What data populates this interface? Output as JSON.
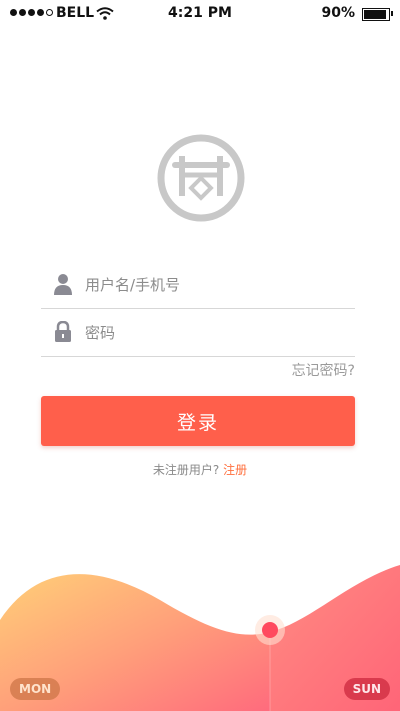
{
  "status_bar": {
    "carrier": "BELL",
    "time": "4:21 PM",
    "battery_percent": "90%",
    "battery_level": 0.9
  },
  "logo": {
    "icon": "temple-gate-logo-icon"
  },
  "form": {
    "username": {
      "placeholder": "用户名/手机号",
      "icon": "user-icon"
    },
    "password": {
      "placeholder": "密码",
      "icon": "lock-icon"
    },
    "forgot_password": "忘记密码?",
    "login_label": "登录",
    "register_prompt": "未注册用户?",
    "register_link": "注册"
  },
  "week_chart": {
    "start_label": "MON",
    "end_label": "SUN"
  },
  "colors": {
    "accent": "#ff5f4b",
    "register_link": "#ff6f3d",
    "wave_start": "#ffc870",
    "wave_end": "#ff6f7d",
    "marker": "#ff4a5f"
  }
}
